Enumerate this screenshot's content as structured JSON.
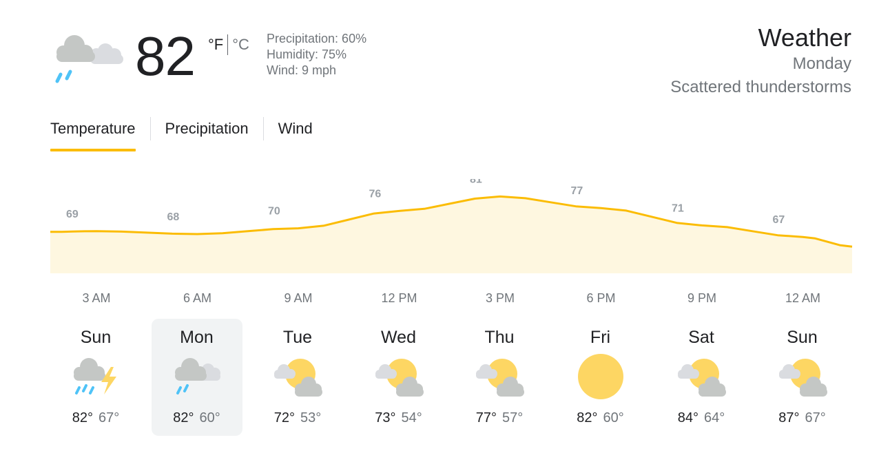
{
  "current": {
    "temperature": "82",
    "unit_f": "°F",
    "unit_c": "°C",
    "icon": "rain-cloud-icon",
    "precipitation": "Precipitation: 60%",
    "humidity": "Humidity: 75%",
    "wind": "Wind: 9 mph"
  },
  "header": {
    "title": "Weather",
    "day": "Monday",
    "condition": "Scattered thunderstorms"
  },
  "tabs": [
    {
      "label": "Temperature",
      "active": true
    },
    {
      "label": "Precipitation",
      "active": false
    },
    {
      "label": "Wind",
      "active": false
    }
  ],
  "colors": {
    "accent": "#fbbc04",
    "chart_fill": "#fef7e0",
    "chart_line": "#fbbc04",
    "rain": "#4fc3f7",
    "sun": "#fdd663",
    "cloud": "#c4c7c5"
  },
  "chart_data": {
    "type": "area",
    "x": [
      "3 AM",
      "6 AM",
      "9 AM",
      "12 PM",
      "3 PM",
      "6 PM",
      "9 PM",
      "12 AM"
    ],
    "values": [
      69,
      68,
      70,
      76,
      81,
      77,
      71,
      67
    ],
    "labels": [
      "69",
      "68",
      "70",
      "76",
      "81",
      "77",
      "71",
      "67"
    ]
  },
  "hours": [
    "3 AM",
    "6 AM",
    "9 AM",
    "12 PM",
    "3 PM",
    "6 PM",
    "9 PM",
    "12 AM"
  ],
  "forecast": [
    {
      "day": "Sun",
      "icon": "thunderstorm-icon",
      "high": "82°",
      "low": "67°",
      "selected": false
    },
    {
      "day": "Mon",
      "icon": "rain-cloud-icon",
      "high": "82°",
      "low": "60°",
      "selected": true
    },
    {
      "day": "Tue",
      "icon": "partly-cloudy-icon",
      "high": "72°",
      "low": "53°",
      "selected": false
    },
    {
      "day": "Wed",
      "icon": "partly-cloudy-icon",
      "high": "73°",
      "low": "54°",
      "selected": false
    },
    {
      "day": "Thu",
      "icon": "partly-cloudy-icon",
      "high": "77°",
      "low": "57°",
      "selected": false
    },
    {
      "day": "Fri",
      "icon": "sunny-icon",
      "high": "82°",
      "low": "60°",
      "selected": false
    },
    {
      "day": "Sat",
      "icon": "partly-cloudy-icon",
      "high": "84°",
      "low": "64°",
      "selected": false
    },
    {
      "day": "Sun",
      "icon": "partly-cloudy-icon",
      "high": "87°",
      "low": "67°",
      "selected": false
    }
  ]
}
